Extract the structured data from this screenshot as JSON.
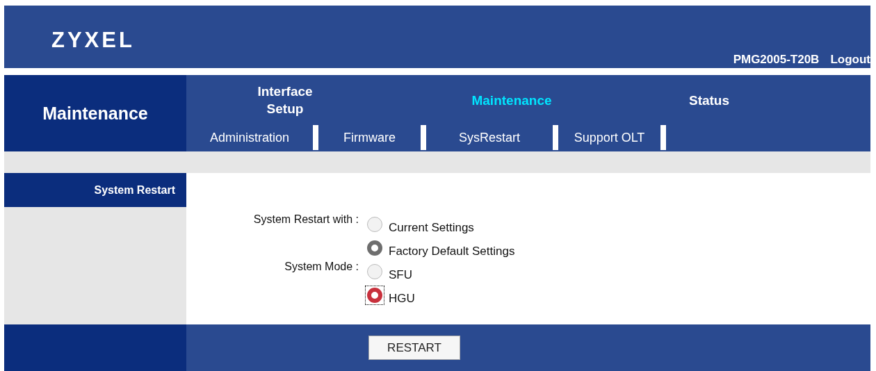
{
  "header": {
    "logo": "ZYXEL",
    "model": "PMG2005-T20B",
    "logout": "Logout"
  },
  "nav": {
    "section_title": "Maintenance",
    "tabs": [
      {
        "label": "Interface\nSetup",
        "selected": false
      },
      {
        "label": "Maintenance",
        "selected": true
      },
      {
        "label": "Status",
        "selected": false
      }
    ],
    "subtabs": [
      "Administration",
      "Firmware",
      "SysRestart",
      "Support OLT"
    ]
  },
  "sidebar": {
    "items": [
      {
        "label": "System Restart",
        "selected": true
      }
    ]
  },
  "form": {
    "groups": [
      {
        "label": "System Restart with :",
        "options": [
          {
            "label": "Current Settings",
            "selected": false,
            "focused": false
          },
          {
            "label": "Factory Default Settings",
            "selected": true,
            "focused": false
          }
        ]
      },
      {
        "label": "System Mode :",
        "options": [
          {
            "label": "SFU",
            "selected": false,
            "focused": false
          },
          {
            "label": "HGU",
            "selected": true,
            "focused": true
          }
        ]
      }
    ]
  },
  "footer": {
    "button": "RESTART"
  }
}
